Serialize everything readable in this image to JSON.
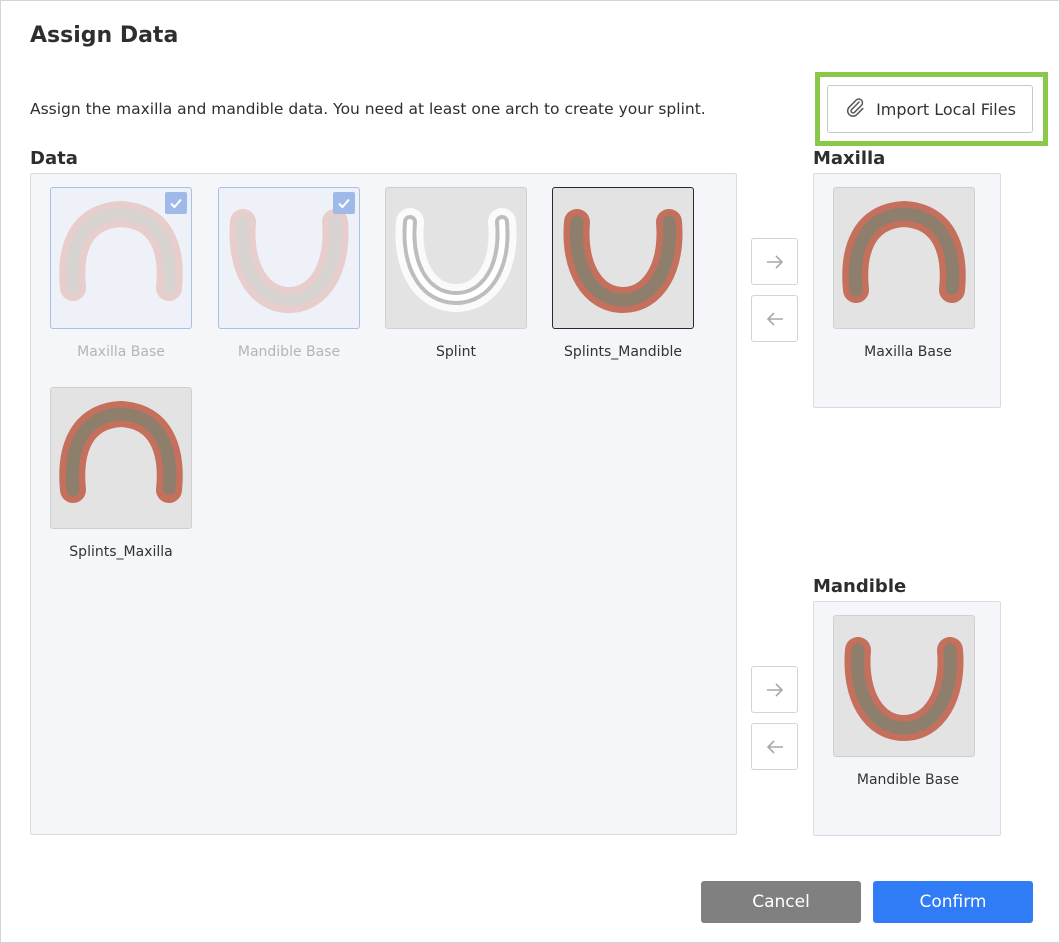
{
  "dialog": {
    "title": "Assign Data",
    "description": "Assign the maxilla and mandible data. You need at least one arch to create your splint.",
    "import_label": "Import Local Files"
  },
  "data_section": {
    "label": "Data",
    "items": [
      {
        "label": "Maxilla Base",
        "state": "assigned",
        "shape": "maxilla",
        "checked": true
      },
      {
        "label": "Mandible Base",
        "state": "assigned",
        "shape": "mandible",
        "checked": true
      },
      {
        "label": "Splint",
        "state": "normal",
        "shape": "splint",
        "checked": false
      },
      {
        "label": "Splints_Mandible",
        "state": "active",
        "shape": "mandible",
        "checked": false
      },
      {
        "label": "Splints_Maxilla",
        "state": "normal",
        "shape": "maxilla",
        "checked": false
      }
    ]
  },
  "maxilla_section": {
    "label": "Maxilla",
    "item_label": "Maxilla Base"
  },
  "mandible_section": {
    "label": "Mandible",
    "item_label": "Mandible Base"
  },
  "footer": {
    "cancel_label": "Cancel",
    "confirm_label": "Confirm"
  },
  "colors": {
    "accent": "#2f7cf6",
    "highlight": "#8ac84a",
    "cancel": "#808080"
  }
}
